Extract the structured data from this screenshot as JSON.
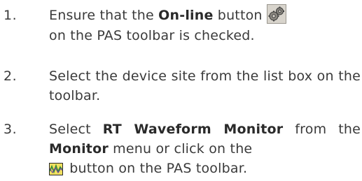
{
  "steps": [
    {
      "number": "1.",
      "line1_before": "Ensure that the ",
      "line1_bold": "On-line",
      "line1_after": " button",
      "icon": "online-gears-icon",
      "line2": "on the PAS toolbar is checked."
    },
    {
      "number": "2.",
      "text": "Select the device site from the list box on the toolbar."
    },
    {
      "number": "3.",
      "t1": "Select ",
      "b1": "RT Waveform Monitor",
      "t2": " from the ",
      "b2": "Monitor",
      "t3": " menu or click on the",
      "icon": "waveform-monitor-icon",
      "t4": " button on the PAS toolbar."
    }
  ],
  "colors": {
    "text": "#3a3a3a",
    "icon_bg": "#d8d4cc",
    "wave_bg": "#f0e060",
    "wave_line": "#2f8a3a"
  }
}
